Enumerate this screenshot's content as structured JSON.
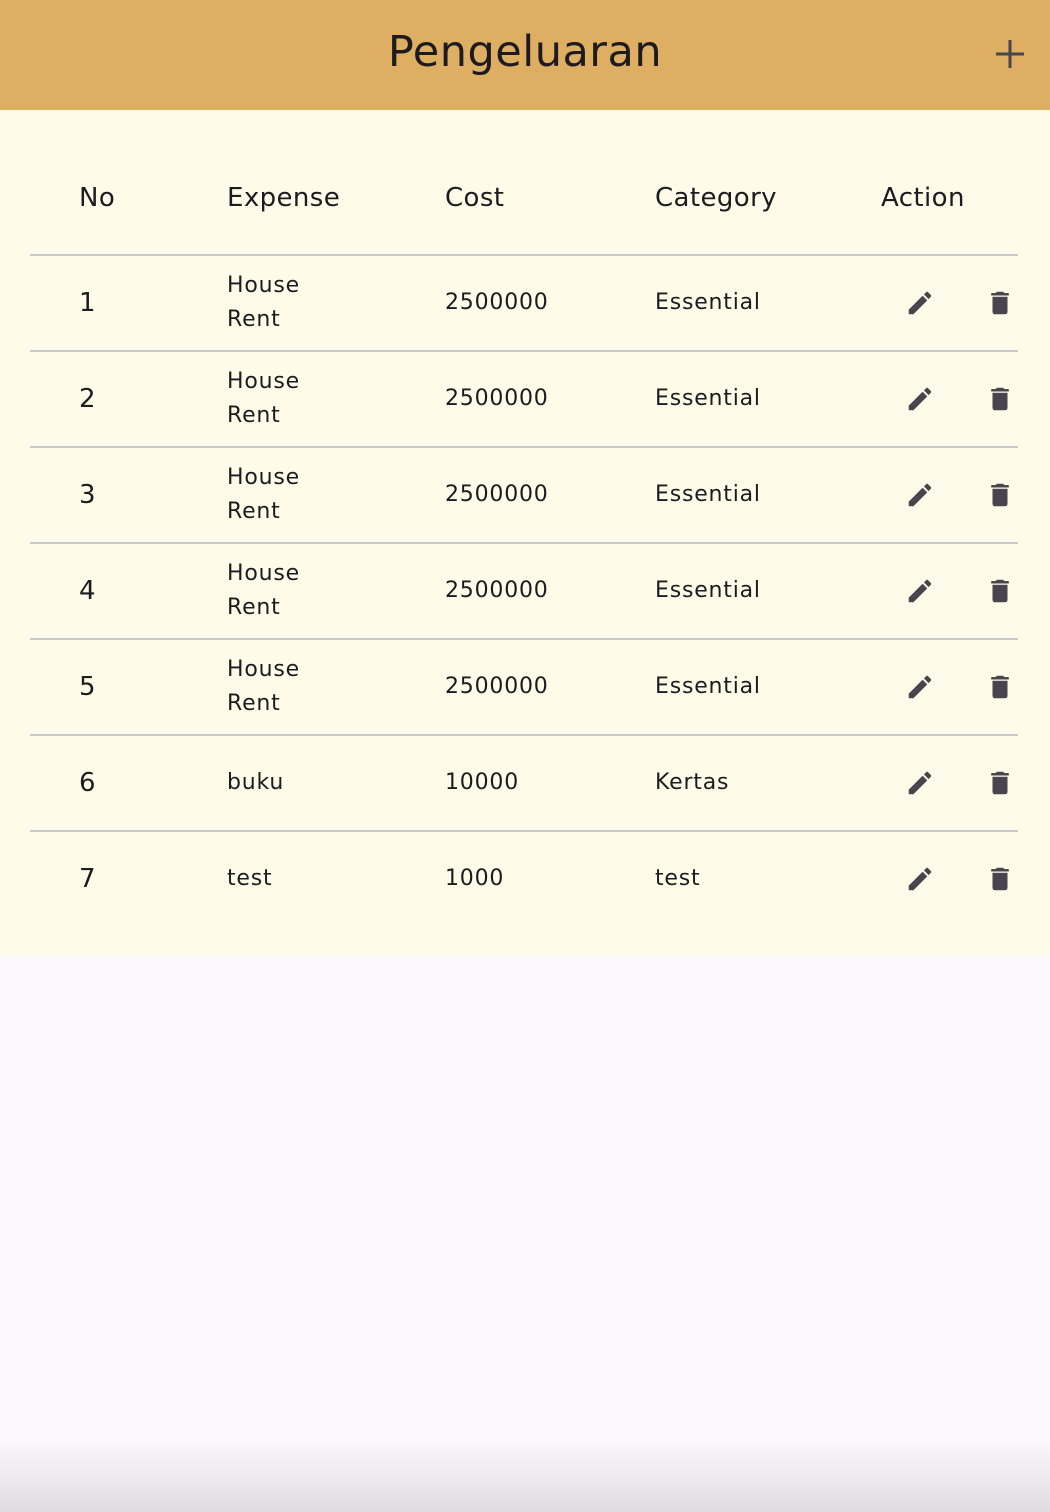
{
  "app_bar": {
    "title": "Pengeluaran",
    "add_icon": "plus-icon",
    "background": "#deae62"
  },
  "table": {
    "columns": [
      "No",
      "Expense",
      "Cost",
      "Category",
      "Action"
    ],
    "rows": [
      {
        "no": "1",
        "expense": "House Rent",
        "cost": "2500000",
        "category": "Essential"
      },
      {
        "no": "2",
        "expense": "House Rent",
        "cost": "2500000",
        "category": "Essential"
      },
      {
        "no": "3",
        "expense": "House Rent",
        "cost": "2500000",
        "category": "Essential"
      },
      {
        "no": "4",
        "expense": "House Rent",
        "cost": "2500000",
        "category": "Essential"
      },
      {
        "no": "5",
        "expense": "House Rent",
        "cost": "2500000",
        "category": "Essential"
      },
      {
        "no": "6",
        "expense": "buku",
        "cost": "10000",
        "category": "Kertas"
      },
      {
        "no": "7",
        "expense": "test",
        "cost": "1000",
        "category": "test"
      }
    ],
    "row_actions": [
      "edit-icon",
      "delete-icon"
    ],
    "background": "#fefbe8"
  },
  "colors": {
    "page_background": "#fbf8fd",
    "icon": "#49454f",
    "divider": "#c9c6cc"
  }
}
